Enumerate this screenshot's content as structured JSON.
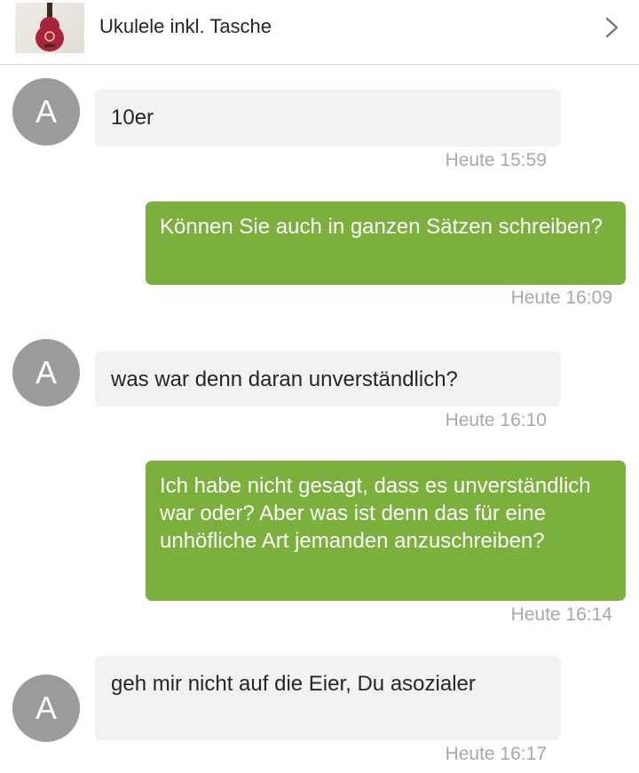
{
  "header": {
    "title": "Ukulele inkl. Tasche",
    "thumbnail_icon": "ukulele-thumbnail",
    "chevron_icon": "chevron-right-icon"
  },
  "messages": [
    {
      "direction": "incoming",
      "avatar": "A",
      "text": "10er",
      "time": "Heute 15:59"
    },
    {
      "direction": "outgoing",
      "text": "Können Sie auch in ganzen Sätzen schreiben?",
      "time": "Heute 16:09"
    },
    {
      "direction": "incoming",
      "avatar": "A",
      "text": "was war denn daran unverständlich?",
      "time": "Heute 16:10"
    },
    {
      "direction": "outgoing",
      "text": "Ich habe nicht gesagt, dass es unverständlich war oder? Aber was ist denn das für eine unhöfliche Art jemanden anzuschreiben?",
      "time": "Heute 16:14"
    },
    {
      "direction": "incoming",
      "avatar": "A",
      "text": "geh mir nicht auf die Eier, Du asozialer",
      "time": "Heute 16:17"
    }
  ],
  "colors": {
    "outgoing_bubble": "#7cb03c",
    "incoming_bubble": "#f2f2f2",
    "avatar": "#9b9b9b",
    "timestamp": "#a8a8a8"
  }
}
